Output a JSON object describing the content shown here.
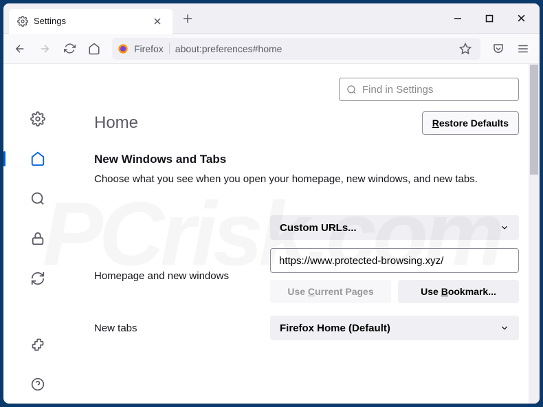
{
  "tab": {
    "title": "Settings"
  },
  "urlbar": {
    "prefix": "Firefox",
    "url": "about:preferences#home"
  },
  "search": {
    "placeholder": "Find in Settings"
  },
  "page": {
    "title": "Home",
    "restore": "estore Defaults",
    "restore_key": "R",
    "section_title": "New Windows and Tabs",
    "section_desc": "Choose what you see when you open your homepage, new windows, and new tabs."
  },
  "home_select": {
    "label": "Custom URLs..."
  },
  "home_row": {
    "label": "Homepage and new windows",
    "value": "https://www.protected-browsing.xyz/"
  },
  "btns": {
    "current_pre": "Use ",
    "current_key": "C",
    "current_post": "urrent Pages",
    "bookmark_pre": "Use ",
    "bookmark_key": "B",
    "bookmark_post": "ookmark..."
  },
  "newtabs_row": {
    "label": "New tabs",
    "select": "Firefox Home (Default)"
  }
}
